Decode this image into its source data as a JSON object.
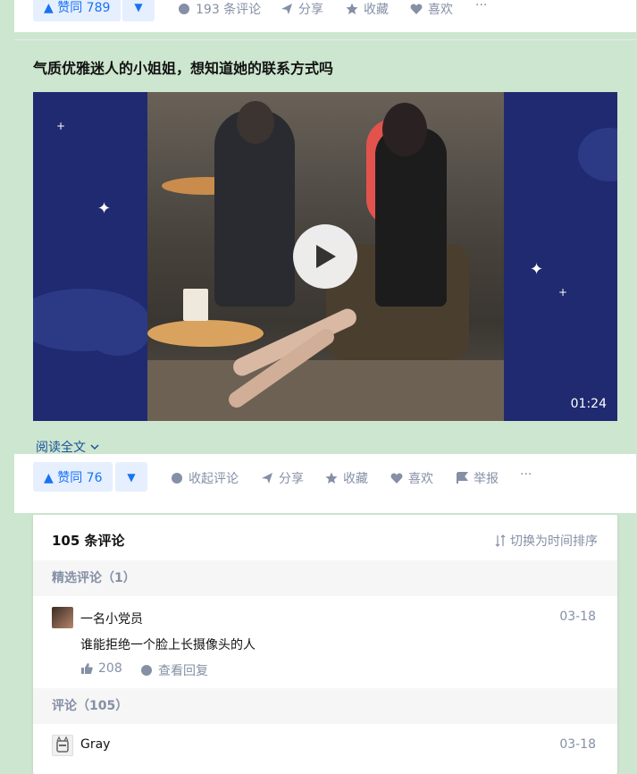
{
  "top_actions": {
    "vote_up": "▲ 赞同 789",
    "comments": "193 条评论",
    "share": "分享",
    "collect": "收藏",
    "like": "喜欢",
    "more": "···"
  },
  "question": {
    "title": "气质优雅迷人的小姐姐，想知道她的联系方式吗"
  },
  "video": {
    "duration": "01:24"
  },
  "read_more": "阅读全文",
  "actions": {
    "vote_up": "▲ 赞同 76",
    "collapse_comments": "收起评论",
    "share": "分享",
    "collect": "收藏",
    "like": "喜欢",
    "report": "举报",
    "more": "···"
  },
  "comments": {
    "count_label": "105 条评论",
    "sort_label": "切换为时间排序",
    "featured_header": "精选评论（1）",
    "featured": [
      {
        "author": "一名小党员",
        "date": "03-18",
        "text": "谁能拒绝一个脸上长摄像头的人",
        "likes": "208",
        "view_replies": "查看回复"
      }
    ],
    "all_header": "评论（105）",
    "list": [
      {
        "author": "Gray",
        "date": "03-18"
      }
    ]
  },
  "colors": {
    "background": "#cde6cf",
    "accent": "#1772f6",
    "muted": "#8590a6"
  }
}
